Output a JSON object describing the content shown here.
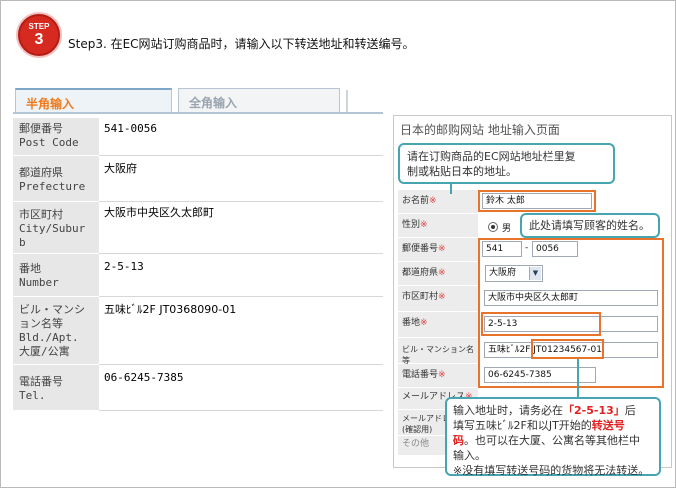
{
  "step": {
    "badge_top": "STEP",
    "badge_num": "3",
    "text": "Step3. 在EC网站订购商品时，请输入以下转送地址和转送编号。"
  },
  "tabs": {
    "half": "半角输入",
    "full": "全角输入"
  },
  "form": {
    "rows": [
      {
        "label_line1": "郵便番号",
        "label_line2": "Post Code",
        "value": "541-0056"
      },
      {
        "label_line1": "都道府県",
        "label_line2": "Prefecture",
        "value": "大阪府"
      },
      {
        "label_line1": "市区町村",
        "label_line2": "City/Subur",
        "label_line3": "b",
        "value": "大阪市中央区久太郎町"
      },
      {
        "label_line1": "番地",
        "label_line2": "Number",
        "value": "2-5-13"
      },
      {
        "label_line1": "ビル・マンシ",
        "label_line2": "ョン名等",
        "label_line3": "Bld./Apt.",
        "label_line4": "大厦/公寓",
        "value": "五味ﾋﾞﾙ2F JT0368090-01"
      },
      {
        "label_line1": "電話番号",
        "label_line2": "Tel.",
        "value": "06-6245-7385"
      }
    ]
  },
  "jp_form": {
    "title": "日本的邮购网站 地址输入页面",
    "callout_top": "请在订购商品的EC网站地址栏里复制或粘贴日本的地址。",
    "callout_top_line1": "请在订购商品的EC网站地址栏里复",
    "callout_top_line2": "制或粘贴日本的地址。",
    "callout_name": "此处请填写顾客的姓名。",
    "name_label": "お名前",
    "name_value": "鈴木 太郎",
    "gender_label": "性別",
    "gender_value": "男",
    "postcode_label": "郵便番号",
    "postcode_1": "541",
    "postcode_sep": "-",
    "postcode_2": "0056",
    "pref_label": "都道府県",
    "pref_value": "大阪府",
    "city_label": "市区町村",
    "city_value": "大阪市中央区久太郎町",
    "number_label": "番地",
    "number_value": "2-5-13",
    "bld_label": "ビル・マンション名等",
    "bld_value_a": "五味ﾋﾞﾙ2F",
    "bld_value_b": "JT01234567-01",
    "tel_label": "電話番号",
    "tel_value": "06-6245-7385",
    "mail_label": "メールアドレス",
    "mail2_label_1": "メールアドレ",
    "mail2_label_2": "(確認用)",
    "other_label": "その他",
    "req_mark": "※"
  },
  "bottom_callout": {
    "line1_a": "输入地址时，请务必在",
    "line1_b": "「2-5-13」",
    "line1_c": "后",
    "line2_a": "填写五味ﾋﾞﾙ2F和以JT开始的",
    "line2_b": "转送号",
    "line3_a": "码",
    "line3_b": "。也可以在大厦、公寓名等其他栏中",
    "line4": "输入。",
    "line5": "※没有填写转送号码的货物将无法转送。"
  }
}
